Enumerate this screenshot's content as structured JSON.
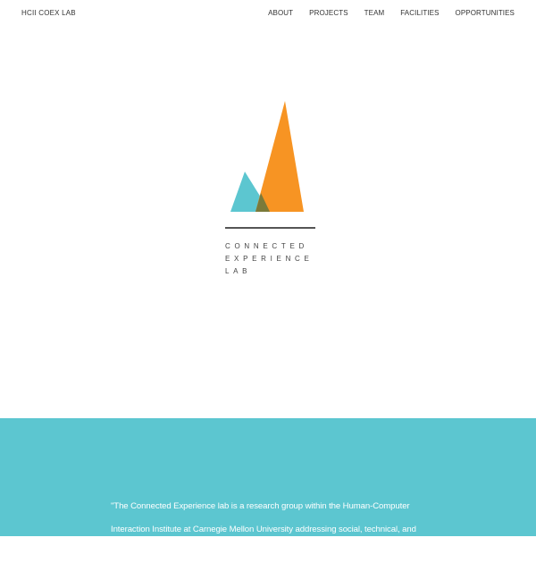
{
  "header": {
    "brand": "HCII COEX LAB",
    "nav": [
      {
        "label": "ABOUT"
      },
      {
        "label": "PROJECTS"
      },
      {
        "label": "TEAM"
      },
      {
        "label": "FACILITIES"
      },
      {
        "label": "OPPORTUNITIES"
      }
    ]
  },
  "logo": {
    "lines": [
      "CONNECTED",
      "EXPERIENCE",
      "LAB"
    ],
    "colors": {
      "teal": "#5cc6d0",
      "orange": "#f79423",
      "overlap": "#7a7a3a",
      "rule": "#555555"
    }
  },
  "about": {
    "text": "\"The Connected Experience lab is a research group within the Human-Computer Interaction Institute at Carnegie Mellon University addressing social, technical, and policy issues emerging around new forms of technology supported work, communication and creative collaboration. The CoEx lab is made up of",
    "background": "#5cc6d0"
  }
}
